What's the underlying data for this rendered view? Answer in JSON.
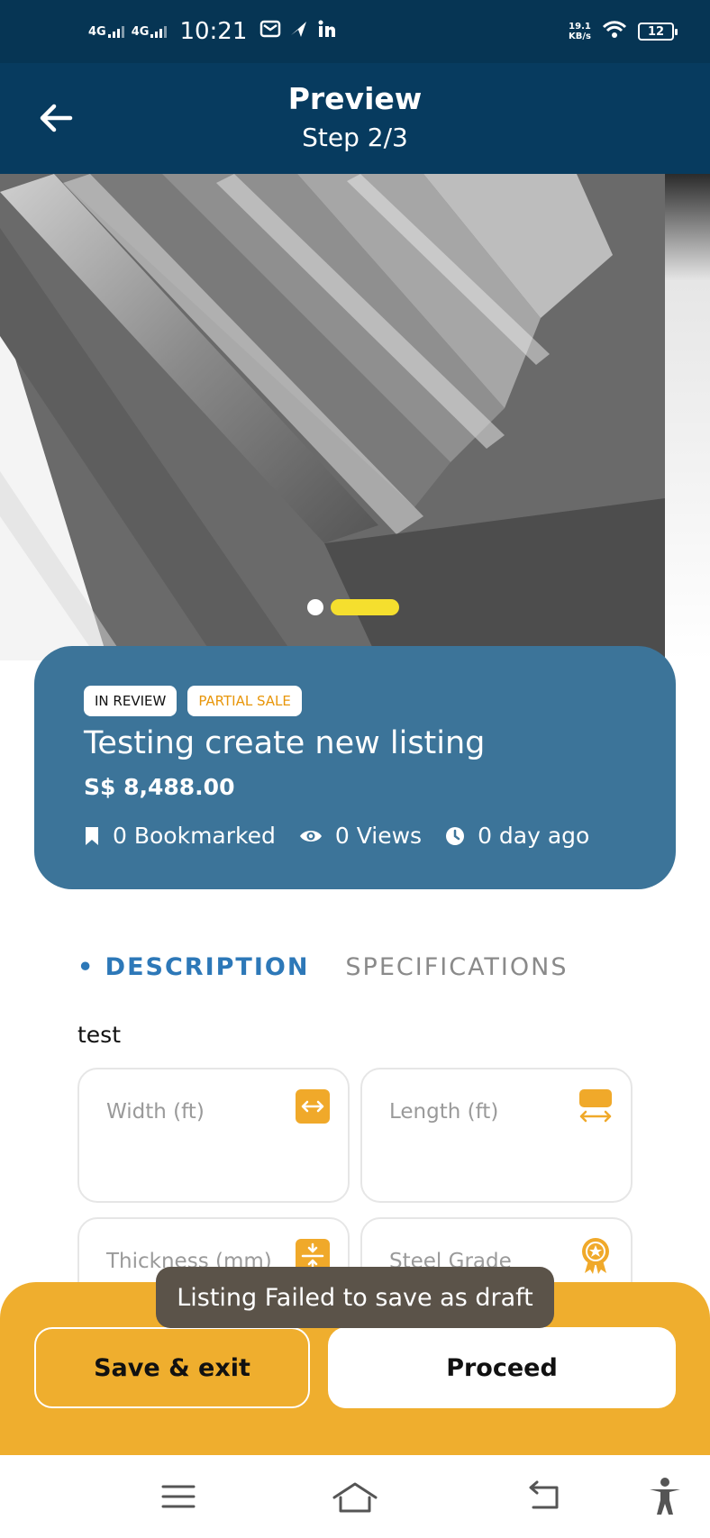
{
  "status_bar": {
    "network1": "4G",
    "network2": "4G",
    "time": "10:21",
    "net_speed_value": "19.1",
    "net_speed_unit": "KB/s",
    "battery": "12",
    "icons": [
      "signal-icon",
      "signal-icon",
      "gmail-icon",
      "send-icon",
      "linkedin-icon",
      "wifi-icon",
      "battery-icon"
    ]
  },
  "header": {
    "title": "Preview",
    "subtitle": "Step 2/3"
  },
  "gallery": {
    "image_count": 2,
    "active_index": 1
  },
  "listing": {
    "badges": {
      "review": "IN REVIEW",
      "partial": "PARTIAL SALE"
    },
    "title": "Testing create new listing",
    "price": "S$ 8,488.00",
    "stats": {
      "bookmarked": "0 Bookmarked",
      "views": "0 Views",
      "age": "0 day ago"
    }
  },
  "tabs": {
    "description": "• DESCRIPTION",
    "specifications": "SPECIFICATIONS"
  },
  "description": {
    "text": "test"
  },
  "specs": {
    "width": "Width (ft)",
    "length": "Length (ft)",
    "thickness": "Thickness (mm)",
    "grade": "Steel Grade"
  },
  "actions": {
    "save_exit": "Save & exit",
    "proceed": "Proceed"
  },
  "toast": {
    "message": "Listing Failed to save as draft"
  },
  "colors": {
    "status_bar": "#063554",
    "app_bar": "#073b5f",
    "card": "#3c7499",
    "accent_orange": "#efae2e",
    "icon_orange": "#f0a92a",
    "tab_active": "#2d78b8",
    "slider_active": "#f5df2e"
  }
}
